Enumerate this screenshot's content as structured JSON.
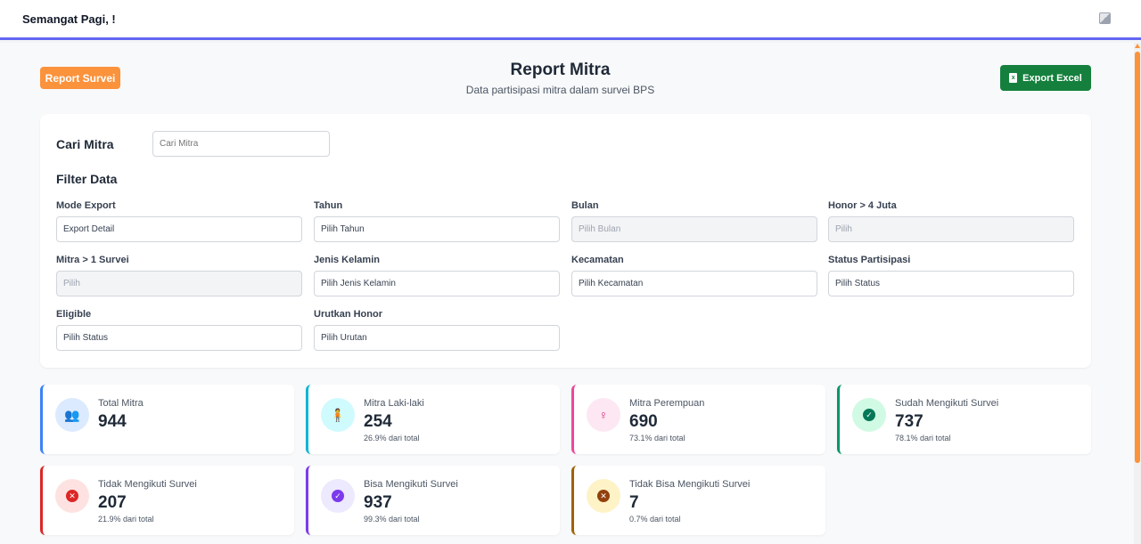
{
  "header": {
    "greeting": "Semangat Pagi, !"
  },
  "page": {
    "badge": "Report Survei",
    "title": "Report Mitra",
    "subtitle": "Data partisipasi mitra dalam survei BPS",
    "export_label": "Export Excel"
  },
  "search": {
    "label": "Cari Mitra",
    "placeholder": "Cari Mitra"
  },
  "filters": {
    "title": "Filter Data",
    "mode_export": {
      "label": "Mode Export",
      "value": "Export Detail"
    },
    "tahun": {
      "label": "Tahun",
      "value": "Pilih Tahun"
    },
    "bulan": {
      "label": "Bulan",
      "value": "Pilih Bulan"
    },
    "honor": {
      "label": "Honor > 4 Juta",
      "value": "Pilih"
    },
    "mitra_survei": {
      "label": "Mitra > 1 Survei",
      "value": "Pilih"
    },
    "jenis_kelamin": {
      "label": "Jenis Kelamin",
      "value": "Pilih Jenis Kelamin"
    },
    "kecamatan": {
      "label": "Kecamatan",
      "value": "Pilih Kecamatan"
    },
    "status_partisipasi": {
      "label": "Status Partisipasi",
      "value": "Pilih Status"
    },
    "eligible": {
      "label": "Eligible",
      "value": "Pilih Status"
    },
    "urutkan_honor": {
      "label": "Urutkan Honor",
      "value": "Pilih Urutan"
    }
  },
  "stats": {
    "total": {
      "label": "Total Mitra",
      "value": "944",
      "sub": "",
      "color": "#3b82f6",
      "icon": "users-icon"
    },
    "laki": {
      "label": "Mitra Laki-laki",
      "value": "254",
      "sub": "26.9% dari total",
      "color": "#06b6d4",
      "icon": "male-icon"
    },
    "perempuan": {
      "label": "Mitra Perempuan",
      "value": "690",
      "sub": "73.1% dari total",
      "color": "#ec4899",
      "icon": "female-icon"
    },
    "sudah": {
      "label": "Sudah Mengikuti Survei",
      "value": "737",
      "sub": "78.1% dari total",
      "color": "#059669",
      "icon": "check-circle-icon"
    },
    "tidak": {
      "label": "Tidak Mengikuti Survei",
      "value": "207",
      "sub": "21.9% dari total",
      "color": "#dc2626",
      "icon": "x-circle-icon"
    },
    "bisa": {
      "label": "Bisa Mengikuti Survei",
      "value": "937",
      "sub": "99.3% dari total",
      "color": "#7c3aed",
      "icon": "check-circle-icon"
    },
    "tidak_bisa": {
      "label": "Tidak Bisa Mengikuti Survei",
      "value": "7",
      "sub": "0.7% dari total",
      "color": "#a16207",
      "icon": "x-circle-icon"
    }
  }
}
